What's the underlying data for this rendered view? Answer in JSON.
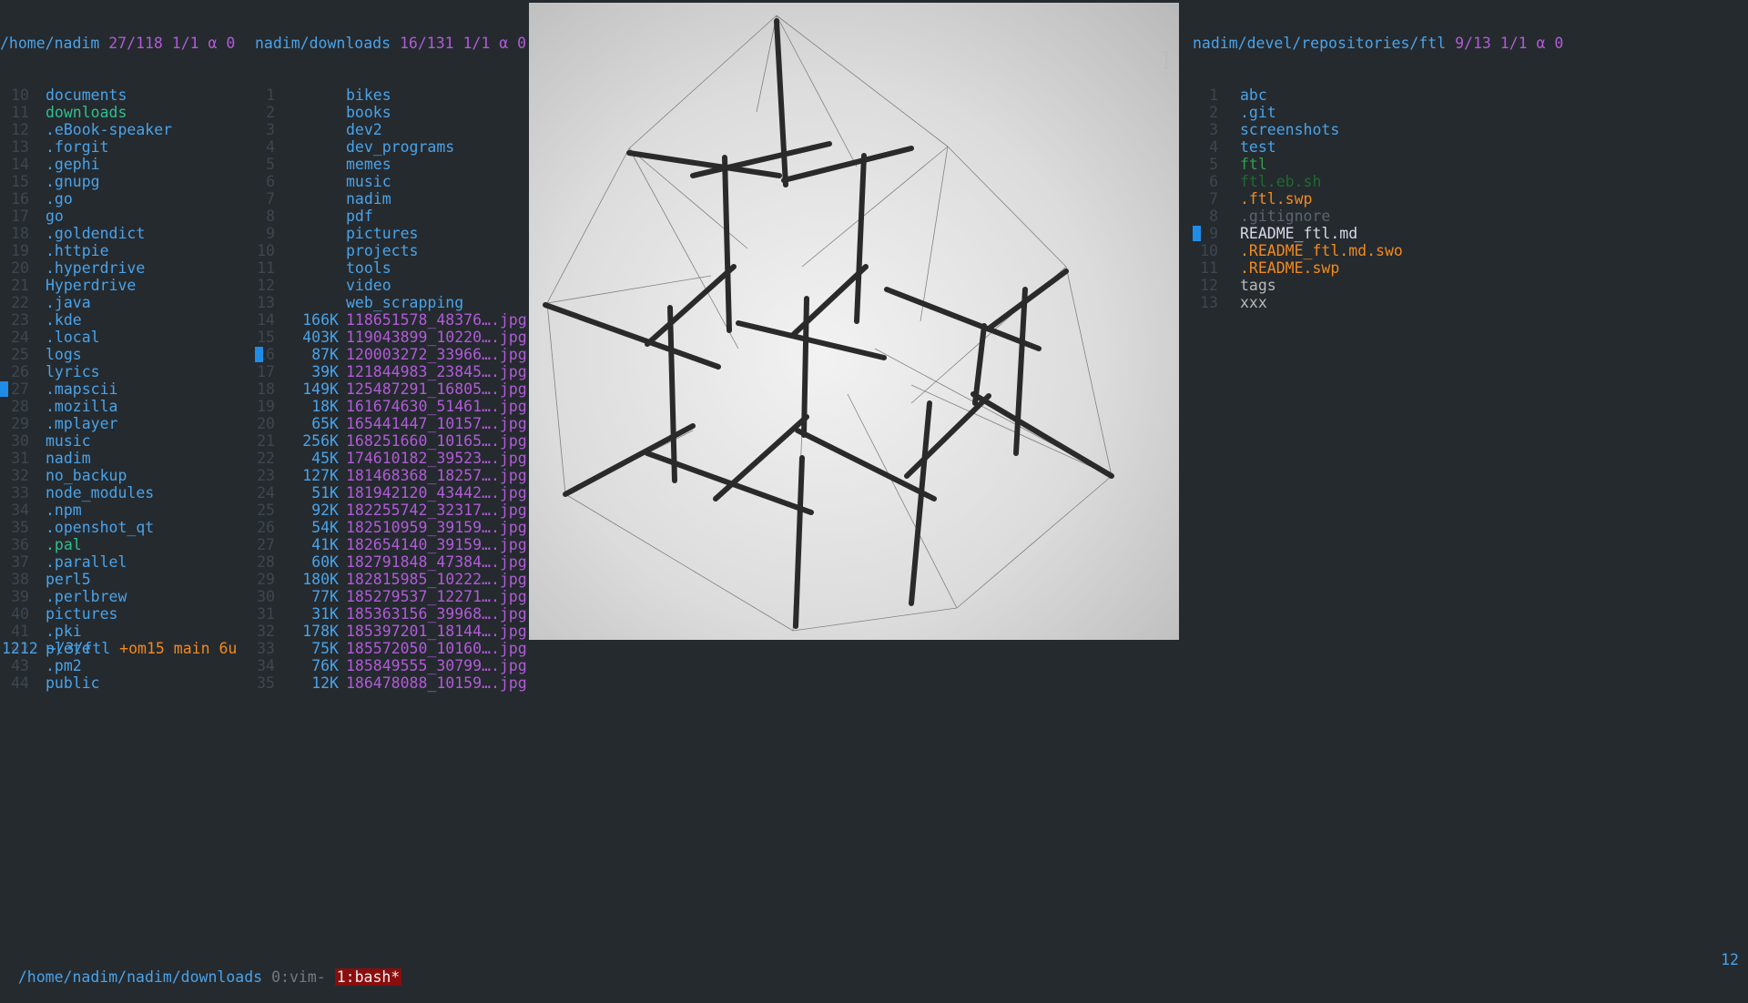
{
  "colors": {
    "background": "#252a2f",
    "directory": "#4aa3e8",
    "info": "#b15bd8",
    "executable": "#2fa04d",
    "orange": "#f28a1e",
    "dim": "#3e4650",
    "cursor": "#1f8ce8"
  },
  "pane1": {
    "path": "/home/nadim",
    "info": "27/118 1/1 α 0",
    "rows": [
      {
        "ln": "10",
        "name": "documents",
        "color": "#4aa3e8"
      },
      {
        "ln": "11",
        "name": "downloads",
        "color": "#2fbf8f"
      },
      {
        "ln": "12",
        "name": ".eBook-speaker",
        "color": "#4aa3e8"
      },
      {
        "ln": "13",
        "name": ".forgit",
        "color": "#4aa3e8"
      },
      {
        "ln": "14",
        "name": ".gephi",
        "color": "#4aa3e8"
      },
      {
        "ln": "15",
        "name": ".gnupg",
        "color": "#4aa3e8"
      },
      {
        "ln": "16",
        "name": ".go",
        "color": "#4aa3e8"
      },
      {
        "ln": "17",
        "name": "go",
        "color": "#4aa3e8"
      },
      {
        "ln": "18",
        "name": ".goldendict",
        "color": "#4aa3e8"
      },
      {
        "ln": "19",
        "name": ".httpie",
        "color": "#4aa3e8"
      },
      {
        "ln": "20",
        "name": ".hyperdrive",
        "color": "#4aa3e8"
      },
      {
        "ln": "21",
        "name": "Hyperdrive",
        "color": "#4aa3e8"
      },
      {
        "ln": "22",
        "name": ".java",
        "color": "#4aa3e8"
      },
      {
        "ln": "23",
        "name": ".kde",
        "color": "#4aa3e8"
      },
      {
        "ln": "24",
        "name": ".local",
        "color": "#4aa3e8"
      },
      {
        "ln": "25",
        "name": "logs",
        "color": "#4aa3e8"
      },
      {
        "ln": "26",
        "name": "lyrics",
        "color": "#4aa3e8"
      },
      {
        "ln": "27",
        "name": ".mapscii",
        "color": "#4aa3e8",
        "cursor": true
      },
      {
        "ln": "28",
        "name": ".mozilla",
        "color": "#4aa3e8"
      },
      {
        "ln": "29",
        "name": ".mplayer",
        "color": "#4aa3e8"
      },
      {
        "ln": "30",
        "name": "music",
        "color": "#4aa3e8"
      },
      {
        "ln": "31",
        "name": "nadim",
        "color": "#4aa3e8"
      },
      {
        "ln": "32",
        "name": "no_backup",
        "color": "#4aa3e8"
      },
      {
        "ln": "33",
        "name": "node_modules",
        "color": "#4aa3e8"
      },
      {
        "ln": "34",
        "name": ".npm",
        "color": "#4aa3e8"
      },
      {
        "ln": "35",
        "name": ".openshot_qt",
        "color": "#4aa3e8"
      },
      {
        "ln": "36",
        "name": ".pal",
        "color": "#2fbf8f"
      },
      {
        "ln": "37",
        "name": ".parallel",
        "color": "#4aa3e8"
      },
      {
        "ln": "38",
        "name": "perl5",
        "color": "#4aa3e8"
      },
      {
        "ln": "39",
        "name": ".perlbrew",
        "color": "#4aa3e8"
      },
      {
        "ln": "40",
        "name": "pictures",
        "color": "#4aa3e8"
      },
      {
        "ln": "41",
        "name": ".pki",
        "color": "#4aa3e8"
      },
      {
        "ln": "42",
        "name": "plete",
        "color": "#4aa3e8"
      },
      {
        "ln": "43",
        "name": ".pm2",
        "color": "#4aa3e8"
      },
      {
        "ln": "44",
        "name": "public",
        "color": "#4aa3e8"
      }
    ]
  },
  "pane2": {
    "path": "nadim/downloads",
    "info": "16/131 1/1 α 0",
    "rows": [
      {
        "ln": "1",
        "size": "",
        "name": "bikes",
        "color": "#4aa3e8"
      },
      {
        "ln": "2",
        "size": "",
        "name": "books",
        "color": "#4aa3e8"
      },
      {
        "ln": "3",
        "size": "",
        "name": "dev2",
        "color": "#4aa3e8"
      },
      {
        "ln": "4",
        "size": "",
        "name": "dev_programs",
        "color": "#4aa3e8"
      },
      {
        "ln": "5",
        "size": "",
        "name": "memes",
        "color": "#4aa3e8"
      },
      {
        "ln": "6",
        "size": "",
        "name": "music",
        "color": "#4aa3e8"
      },
      {
        "ln": "7",
        "size": "",
        "name": "nadim",
        "color": "#4aa3e8"
      },
      {
        "ln": "8",
        "size": "",
        "name": "pdf",
        "color": "#4aa3e8"
      },
      {
        "ln": "9",
        "size": "",
        "name": "pictures",
        "color": "#4aa3e8"
      },
      {
        "ln": "10",
        "size": "",
        "name": "projects",
        "color": "#4aa3e8"
      },
      {
        "ln": "11",
        "size": "",
        "name": "tools",
        "color": "#4aa3e8"
      },
      {
        "ln": "12",
        "size": "",
        "name": "video",
        "color": "#4aa3e8"
      },
      {
        "ln": "13",
        "size": "",
        "name": "web_scrapping",
        "color": "#4aa3e8"
      },
      {
        "ln": "14",
        "size": "166K",
        "name": "118651578_48376….jpg",
        "color": "#b15bd8"
      },
      {
        "ln": "15",
        "size": "403K",
        "name": "119043899_10220….jpg",
        "color": "#b15bd8"
      },
      {
        "ln": "16",
        "size": "87K",
        "name": "120003272_33966….jpg",
        "color": "#b15bd8",
        "cursor": true
      },
      {
        "ln": "17",
        "size": "39K",
        "name": "121844983_23845….jpg",
        "color": "#b15bd8"
      },
      {
        "ln": "18",
        "size": "149K",
        "name": "125487291_16805….jpg",
        "color": "#b15bd8"
      },
      {
        "ln": "19",
        "size": "18K",
        "name": "161674630_51461….jpg",
        "color": "#b15bd8"
      },
      {
        "ln": "20",
        "size": "65K",
        "name": "165441447_10157….jpg",
        "color": "#b15bd8"
      },
      {
        "ln": "21",
        "size": "256K",
        "name": "168251660_10165….jpg",
        "color": "#b15bd8"
      },
      {
        "ln": "22",
        "size": "45K",
        "name": "174610182_39523….jpg",
        "color": "#b15bd8"
      },
      {
        "ln": "23",
        "size": "127K",
        "name": "181468368_18257….jpg",
        "color": "#b15bd8"
      },
      {
        "ln": "24",
        "size": "51K",
        "name": "181942120_43442….jpg",
        "color": "#b15bd8"
      },
      {
        "ln": "25",
        "size": "92K",
        "name": "182255742_32317….jpg",
        "color": "#b15bd8"
      },
      {
        "ln": "26",
        "size": "54K",
        "name": "182510959_39159….jpg",
        "color": "#b15bd8"
      },
      {
        "ln": "27",
        "size": "41K",
        "name": "182654140_39159….jpg",
        "color": "#b15bd8"
      },
      {
        "ln": "28",
        "size": "60K",
        "name": "182791848_47384….jpg",
        "color": "#b15bd8"
      },
      {
        "ln": "29",
        "size": "180K",
        "name": "182815985_10222….jpg",
        "color": "#b15bd8"
      },
      {
        "ln": "30",
        "size": "77K",
        "name": "185279537_12271….jpg",
        "color": "#b15bd8"
      },
      {
        "ln": "31",
        "size": "31K",
        "name": "185363156_39968….jpg",
        "color": "#b15bd8"
      },
      {
        "ln": "32",
        "size": "178K",
        "name": "185397201_18144….jpg",
        "color": "#b15bd8"
      },
      {
        "ln": "33",
        "size": "75K",
        "name": "185572050_10160….jpg",
        "color": "#b15bd8"
      },
      {
        "ln": "34",
        "size": "76K",
        "name": "185849555_30799….jpg",
        "color": "#b15bd8"
      },
      {
        "ln": "35",
        "size": "12K",
        "name": "186478088_10159….jpg",
        "color": "#b15bd8"
      }
    ]
  },
  "pane3": {
    "path": "nadim/devel/repositories/ftl",
    "info": "9/13 1/1 α 0",
    "rows": [
      {
        "ln": "1",
        "name": "abc",
        "color": "#4aa3e8"
      },
      {
        "ln": "2",
        "name": ".git",
        "color": "#4aa3e8"
      },
      {
        "ln": "3",
        "name": "screenshots",
        "color": "#4aa3e8"
      },
      {
        "ln": "4",
        "name": "test",
        "color": "#4aa3e8"
      },
      {
        "ln": "5",
        "name": "ftl",
        "color": "#2fa04d"
      },
      {
        "ln": "6",
        "name": "ftl.eb.sh",
        "color": "#1d6b2e"
      },
      {
        "ln": "7",
        "name": ".ftl.swp",
        "color": "#f28a1e"
      },
      {
        "ln": "8",
        "name": ".gitignore",
        "color": "#5c6470"
      },
      {
        "ln": "9",
        "name": "README_ftl.md",
        "color": "#d8d8e8",
        "cursor": true
      },
      {
        "ln": "10",
        "name": ".README_ftl.md.swo",
        "color": "#f28a1e"
      },
      {
        "ln": "11",
        "name": ".README.swp",
        "color": "#f28a1e"
      },
      {
        "ln": "12",
        "name": "tags",
        "color": "#b8b8b8"
      },
      {
        "ln": "13",
        "name": "xxx",
        "color": "#b8b8b8"
      }
    ]
  },
  "prompt": {
    "count": "1212",
    "dir": "~/3/ftl",
    "git": "+om15 main 6u"
  },
  "statusbar": {
    "path": "/home/nadim/nadim/downloads",
    "window0": "0:vim-",
    "window1": "1:bash*",
    "right": "12"
  },
  "preview": {
    "icon": "image-preview"
  }
}
